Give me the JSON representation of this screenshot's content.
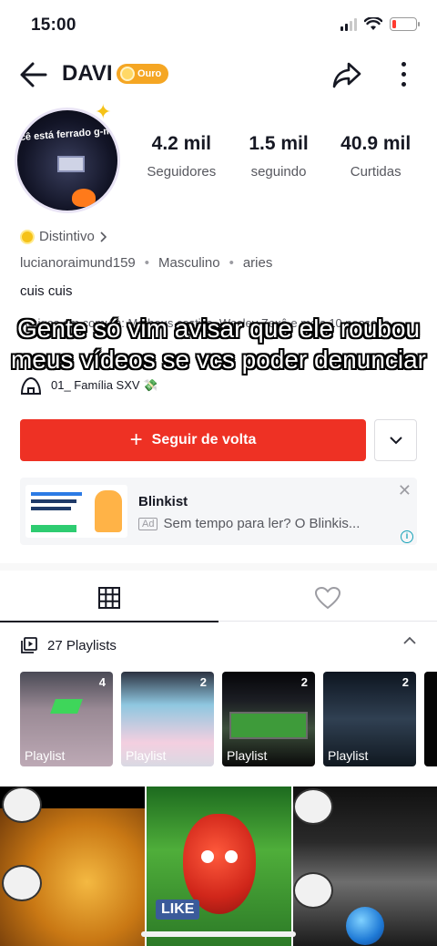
{
  "status_bar": {
    "time": "15:00",
    "battery_level": 0.15,
    "battery_color": "#ff3b30"
  },
  "header": {
    "username": "DAVI",
    "badge_label": "Ouro",
    "icons": [
      "back-arrow-icon",
      "share-icon",
      "more-icon"
    ]
  },
  "profile": {
    "avatar_text": "ocê está ferrado g-ma",
    "stats": [
      {
        "value": "4.2 mil",
        "label": "Seguidores"
      },
      {
        "value": "1.5 mil",
        "label": "seguindo"
      },
      {
        "value": "40.9 mil",
        "label": "Curtidas"
      }
    ],
    "distinct_label": "Distintivo",
    "handle": "lucianoraimund159",
    "gender": "Masculino",
    "sign": "aries",
    "bio": "cuis cuis",
    "mutual_followers": "Amigos em comum: Matheus castillo, Wesley Zexô e mais 10 pessoas",
    "family_text": "01_ Família SXV 💸"
  },
  "overlay_caption": "Gente só vim avisar que ele roubou meus vídeos se vcs poder denunciar",
  "actions": {
    "follow_back_label": "Seguir de volta",
    "accent_color": "#ee3124"
  },
  "ad": {
    "title": "Blinkist",
    "ad_tag": "Ad",
    "subtitle": "Sem tempo para ler? O Blinkis..."
  },
  "tabs": [
    {
      "name": "videos-grid",
      "icon": "grid-icon",
      "active": true
    },
    {
      "name": "liked",
      "icon": "heart-icon",
      "active": false
    }
  ],
  "playlists": {
    "header": "27 Playlists",
    "items": [
      {
        "label": "Playlist",
        "count": "4"
      },
      {
        "label": "Playlist",
        "count": "2"
      },
      {
        "label": "Playlist",
        "count": "2"
      },
      {
        "label": "Playlist",
        "count": "2"
      },
      {
        "label": "",
        "count": ""
      }
    ]
  }
}
